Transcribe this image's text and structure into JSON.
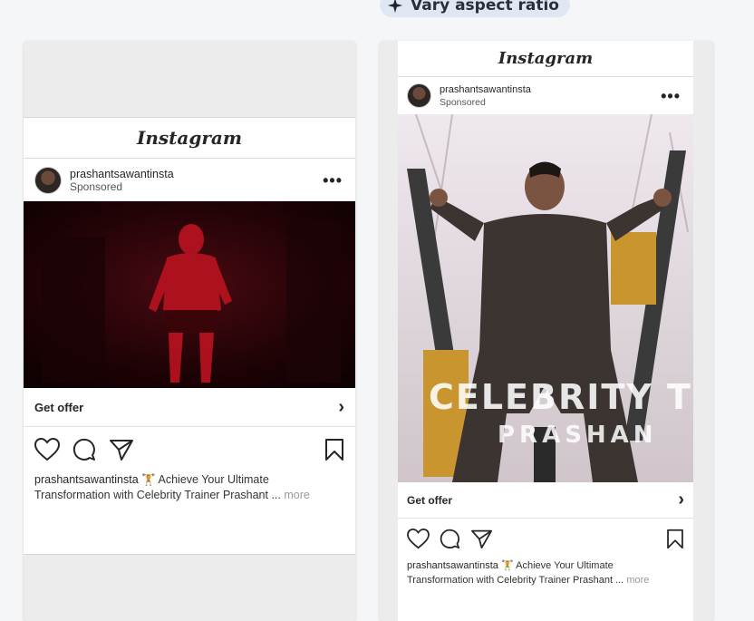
{
  "toolbar": {
    "vary_aspect_label": "Vary aspect ratio"
  },
  "previews": [
    {
      "brand": "Instagram",
      "username": "prashantsawantinsta",
      "sponsored": "Sponsored",
      "cta": "Get offer",
      "caption_user": "prashantsawantinsta",
      "caption_emoji": "🏋",
      "caption_line1": "Achieve Your Ultimate",
      "caption_line2": "Transformation with Celebrity Trainer Prashant ...",
      "caption_more": "more"
    },
    {
      "brand": "Instagram",
      "username": "prashantsawantinsta",
      "sponsored": "Sponsored",
      "cta": "Get offer",
      "overlay_line1": "CELEBRITY T",
      "overlay_line2": "PRASHAN",
      "caption_user": "prashantsawantinsta",
      "caption_emoji": "🏋",
      "caption_line1": "Achieve Your Ultimate",
      "caption_line2": "Transformation with Celebrity Trainer Prashant ...",
      "caption_more": "more"
    }
  ]
}
